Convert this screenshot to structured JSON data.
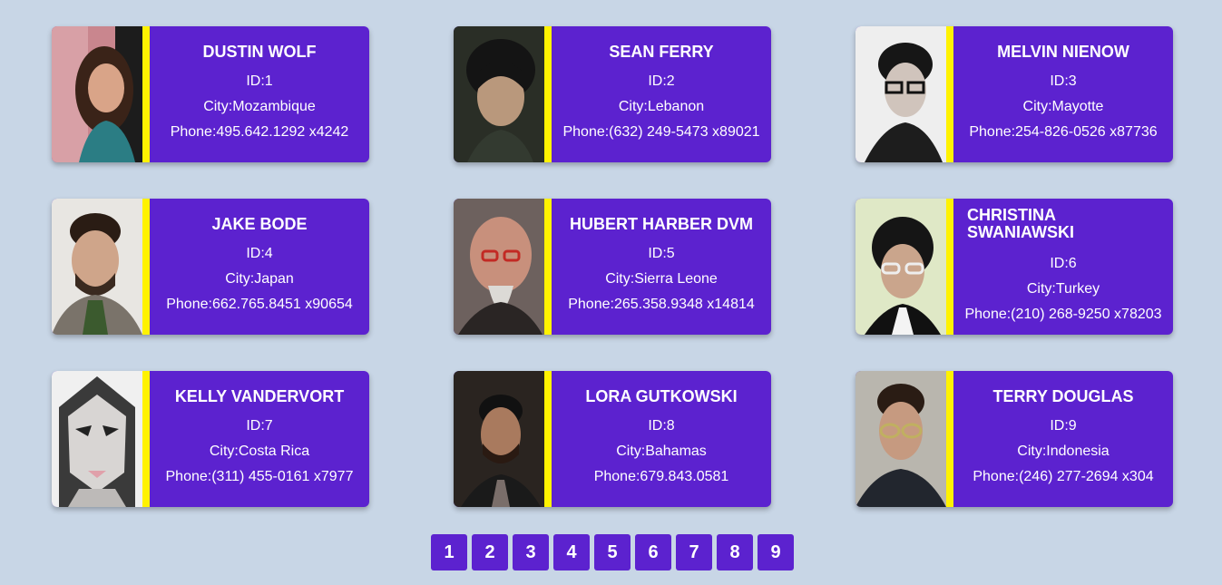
{
  "cards": [
    {
      "name": "DUSTIN WOLF",
      "id": "ID:1",
      "city": "City:Mozambique",
      "phone": "Phone:495.642.1292 x4242"
    },
    {
      "name": "SEAN FERRY",
      "id": "ID:2",
      "city": "City:Lebanon",
      "phone": "Phone:(632) 249-5473 x89021"
    },
    {
      "name": "MELVIN NIENOW",
      "id": "ID:3",
      "city": "City:Mayotte",
      "phone": "Phone:254-826-0526 x87736"
    },
    {
      "name": "JAKE BODE",
      "id": "ID:4",
      "city": "City:Japan",
      "phone": "Phone:662.765.8451 x90654"
    },
    {
      "name": "HUBERT HARBER DVM",
      "id": "ID:5",
      "city": "City:Sierra Leone",
      "phone": "Phone:265.358.9348 x14814"
    },
    {
      "name": "CHRISTINA SWANIAWSKI",
      "id": "ID:6",
      "city": "City:Turkey",
      "phone": "Phone:(210) 268-9250 x78203"
    },
    {
      "name": "KELLY VANDERVORT",
      "id": "ID:7",
      "city": "City:Costa Rica",
      "phone": "Phone:(311) 455-0161 x7977"
    },
    {
      "name": "LORA GUTKOWSKI",
      "id": "ID:8",
      "city": "City:Bahamas",
      "phone": "Phone:679.843.0581"
    },
    {
      "name": "TERRY DOUGLAS",
      "id": "ID:9",
      "city": "City:Indonesia",
      "phone": "Phone:(246) 277-2694 x304"
    }
  ],
  "pagination": [
    "1",
    "2",
    "3",
    "4",
    "5",
    "6",
    "7",
    "8",
    "9"
  ],
  "colors": {
    "background": "#c8d6e6",
    "card": "#5c22cf",
    "stripe": "#fff200",
    "text": "#ffffff"
  }
}
